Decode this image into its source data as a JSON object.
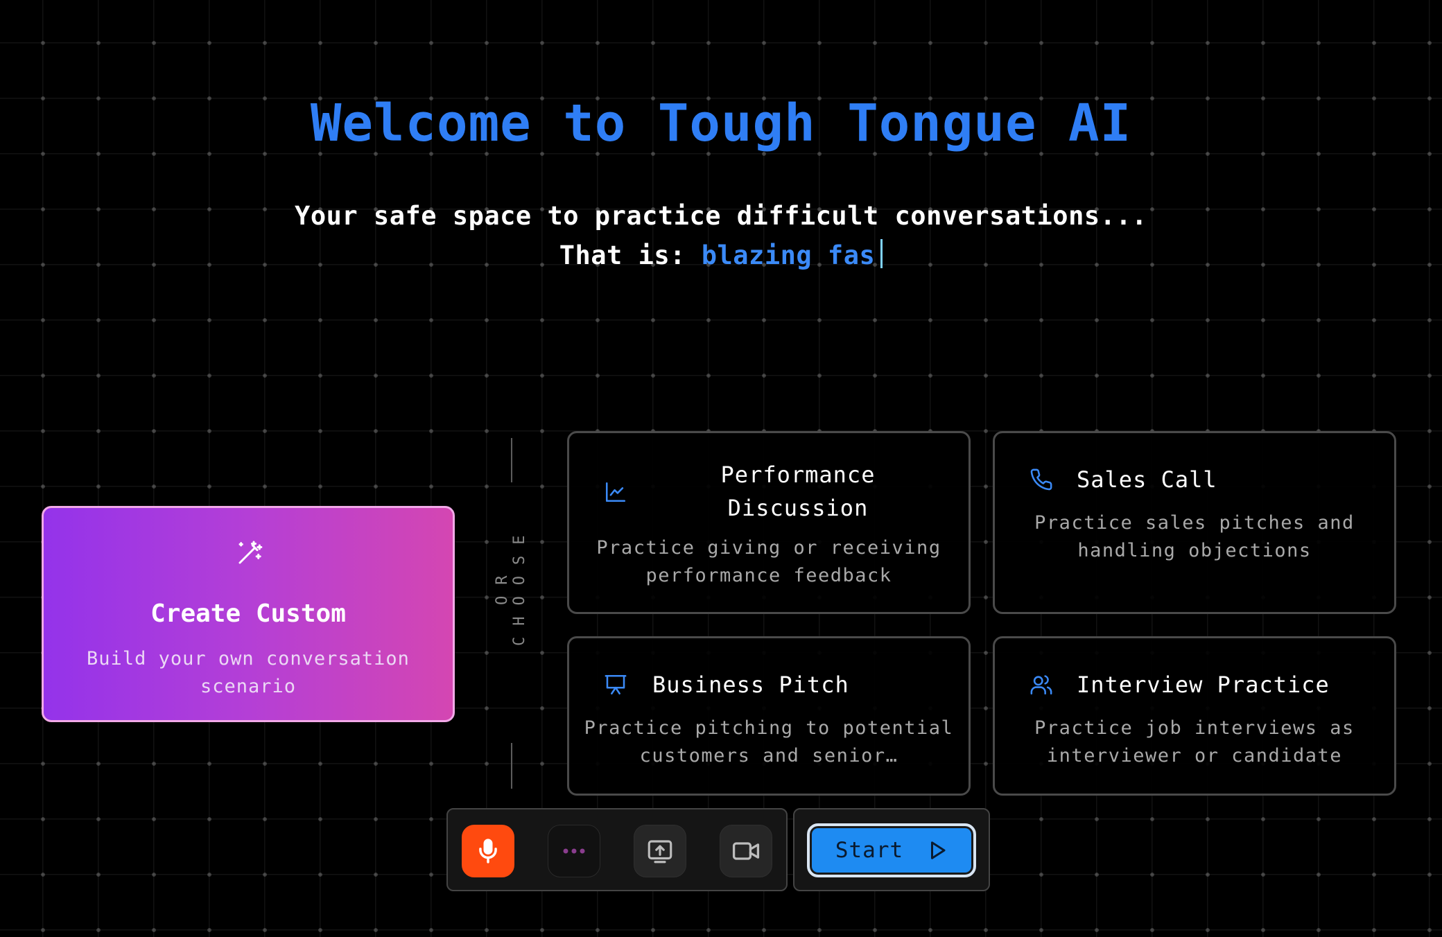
{
  "header": {
    "title": "Welcome to Tough Tongue AI",
    "subtitle": "Your safe space to practice difficult conversations...",
    "tagline_prefix": "That is: ",
    "tagline_typed": "blazing fas"
  },
  "custom_card": {
    "icon": "magic-wand-icon",
    "title": "Create Custom",
    "description": "Build your own conversation scenario"
  },
  "divider": {
    "label": "OR CHOOSE"
  },
  "scenarios": [
    {
      "icon": "chart-line-icon",
      "title": "Performance Discussion",
      "description": "Practice giving or receiving performance feedback"
    },
    {
      "icon": "phone-icon",
      "title": "Sales Call",
      "description": "Practice sales pitches and handling objections"
    },
    {
      "icon": "presentation-icon",
      "title": "Business Pitch",
      "description": "Practice pitching to potential customers and senior…"
    },
    {
      "icon": "users-icon",
      "title": "Interview Practice",
      "description": "Practice job interviews as interviewer or candidate"
    }
  ],
  "controls": {
    "buttons": [
      "microphone-icon",
      "more-dots-icon",
      "screen-share-icon",
      "video-camera-icon"
    ],
    "start_label": "Start"
  },
  "colors": {
    "accent_blue": "#2f7ef5",
    "custom_gradient_start": "#9433ea",
    "custom_gradient_end": "#d446b2",
    "mic_orange": "#ff4a0f",
    "start_blue": "#1e8bf2"
  }
}
